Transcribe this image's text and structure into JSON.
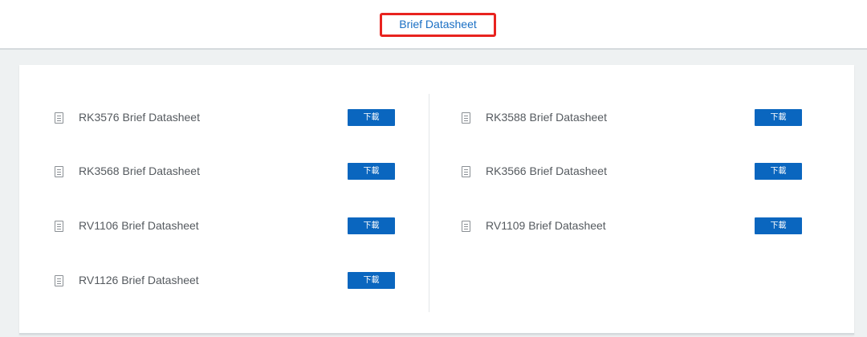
{
  "header": {
    "active_tab": "Brief Datasheet"
  },
  "left_column": {
    "items": [
      {
        "label": "RK3576 Brief Datasheet",
        "button": "下載"
      },
      {
        "label": "RK3568 Brief Datasheet",
        "button": "下載"
      },
      {
        "label": "RV1106 Brief Datasheet",
        "button": "下載"
      },
      {
        "label": "RV1126 Brief Datasheet",
        "button": "下載"
      }
    ]
  },
  "right_column": {
    "items": [
      {
        "label": "RK3588 Brief Datasheet",
        "button": "下載"
      },
      {
        "label": "RK3566 Brief Datasheet",
        "button": "下載"
      },
      {
        "label": "RV1109 Brief Datasheet",
        "button": "下載"
      }
    ]
  },
  "icons": {
    "row_icon": "document-icon"
  },
  "colors": {
    "accent": "#0a66bf",
    "tab_text": "#1a6fc4",
    "highlight_border": "#e8231f",
    "background": "#eef1f2"
  }
}
